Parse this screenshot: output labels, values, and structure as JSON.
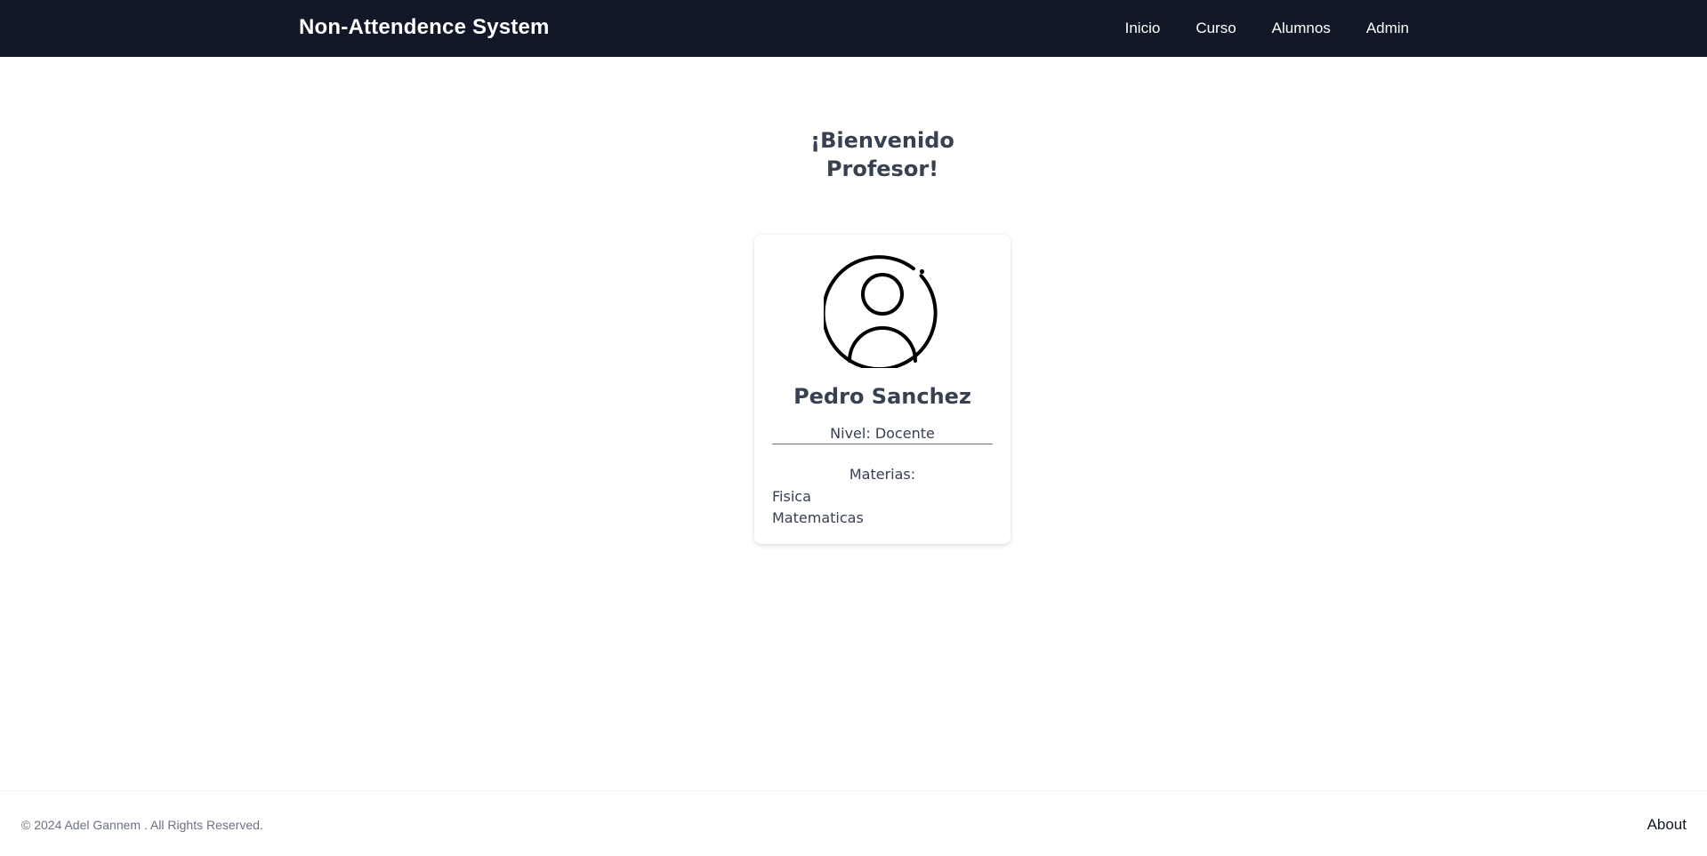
{
  "header": {
    "brand": "Non-Attendence System",
    "nav": [
      "Inicio",
      "Curso",
      "Alumnos",
      "Admin"
    ]
  },
  "main": {
    "welcome_line1": "¡Bienvenido",
    "welcome_line2": "Profesor!"
  },
  "profile_card": {
    "avatar_icon": "user-circle-icon",
    "name": "Pedro Sanchez",
    "level": "Nivel: Docente",
    "subjects_title": "Materias:",
    "subjects": [
      "Fisica",
      "Matematicas"
    ]
  },
  "footer": {
    "copyright": "© 2024 Adel Gannem . All Rights Reserved.",
    "about": "About"
  },
  "colors": {
    "navbar_bg": "#111827",
    "text_primary": "#374151",
    "text_muted": "#6b7280"
  }
}
